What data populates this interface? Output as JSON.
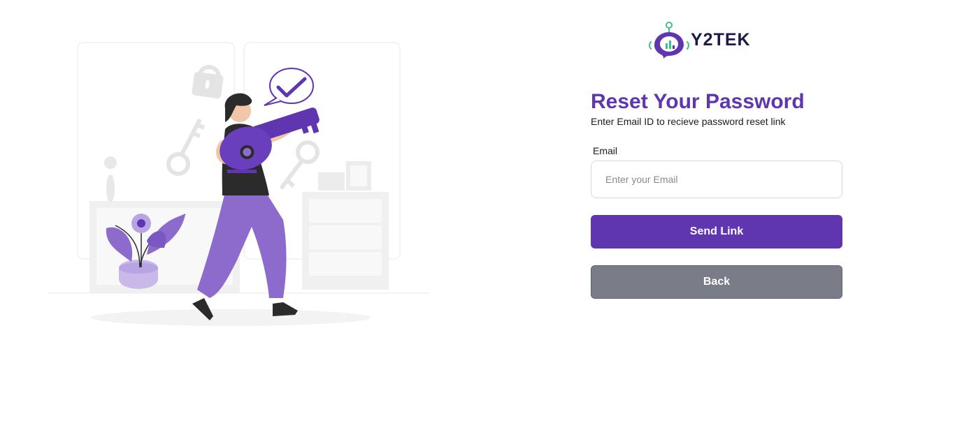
{
  "brand": {
    "name": "Y2TEK"
  },
  "reset": {
    "title": "Reset Your Password",
    "subtitle": "Enter Email ID to recieve password reset link",
    "email_label": "Email",
    "email_placeholder": "Enter your Email",
    "email_value": "",
    "send_label": "Send Link",
    "back_label": "Back"
  },
  "colors": {
    "accent": "#5f35b0",
    "secondary_button": "#7a7c88",
    "illustration_purple": "#8d6bcd"
  },
  "icons": [
    "lock-icon",
    "key-icon",
    "checkmark-bubble-icon",
    "flower-icon"
  ]
}
